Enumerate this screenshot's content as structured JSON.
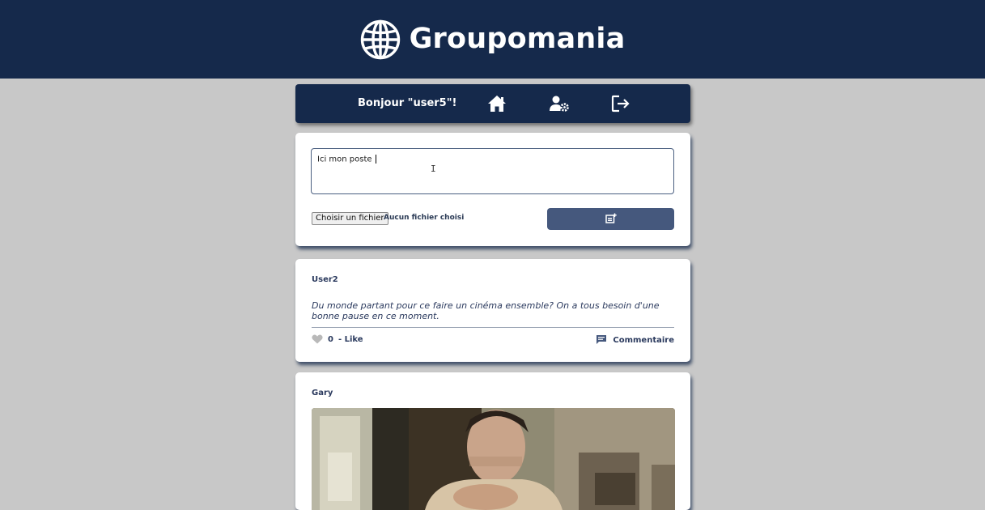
{
  "header": {
    "brand": "Groupomania",
    "logo_icon": "globe-icon",
    "background": "#15294b"
  },
  "nav": {
    "greeting": "Bonjour \"user5\"!",
    "buttons": [
      {
        "icon": "home-icon"
      },
      {
        "icon": "user-settings-icon"
      },
      {
        "icon": "logout-icon"
      }
    ]
  },
  "composer": {
    "text_value": "Ici mon poste ",
    "file_button": "Choisir un fichier",
    "file_status": "Aucun fichier choisi",
    "submit_icon": "new-post-icon"
  },
  "posts": [
    {
      "author": "User2",
      "text": "Du monde partant pour ce faire un cinéma ensemble? On a tous besoin d'une bonne pause en ce moment.",
      "likes": "0",
      "like_label": "- Like",
      "comment_label": "Commentaire"
    },
    {
      "author": "Gary",
      "image": "gif-image"
    }
  ],
  "colors": {
    "navy": "#15294b",
    "button": "#45587d",
    "page_bg": "#c8c8c8"
  }
}
